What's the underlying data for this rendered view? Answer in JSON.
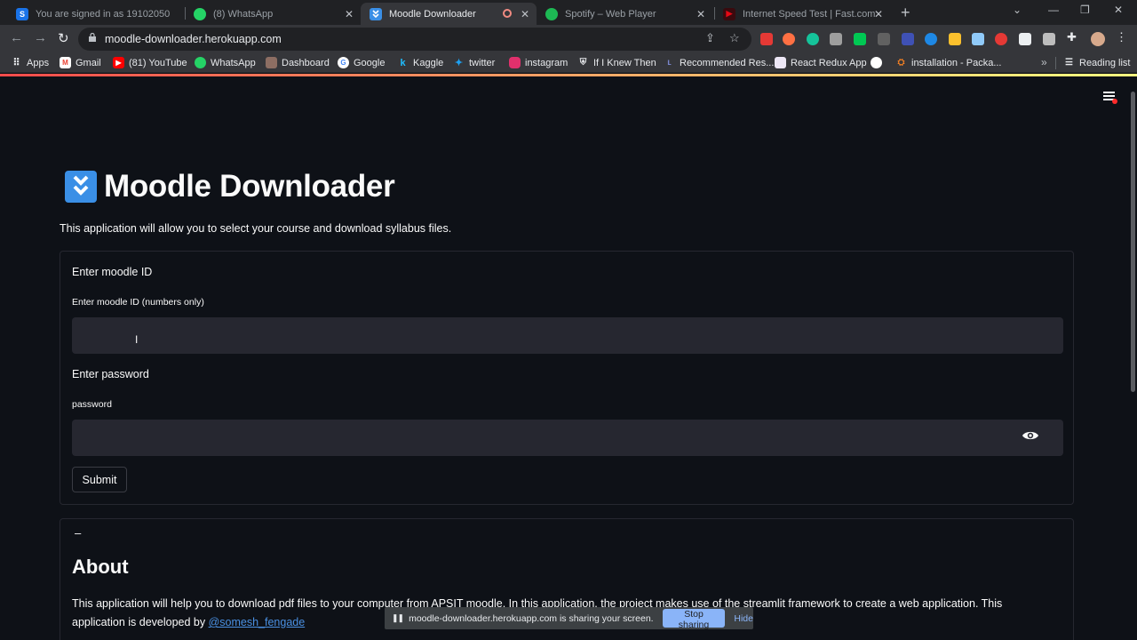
{
  "tabs": [
    {
      "title": "You are signed in as 19102050",
      "favicon_letter": "S",
      "color": "#1a73e8"
    },
    {
      "title": "(8) WhatsApp",
      "favicon_letter": "",
      "color": "#25d366"
    },
    {
      "title": "Moodle Downloader",
      "favicon_letter": "",
      "color": "#3a8fe6",
      "active": true
    },
    {
      "title": "Spotify – Web Player",
      "favicon_letter": "",
      "color": "#1db954"
    },
    {
      "title": "Internet Speed Test | Fast.com",
      "favicon_letter": "",
      "color": "#e50914"
    }
  ],
  "toolbar": {
    "url": "moodle-downloader.herokuapp.com"
  },
  "bookmarks": [
    {
      "label": "Apps",
      "color": "#4285f4"
    },
    {
      "label": "Gmail",
      "color": "#ea4335"
    },
    {
      "label": "(81) YouTube",
      "color": "#ff0000"
    },
    {
      "label": "WhatsApp",
      "color": "#25d366"
    },
    {
      "label": "Dashboard",
      "color": "#8d6e63"
    },
    {
      "label": "Google",
      "color": "#4285f4"
    },
    {
      "label": "Kaggle",
      "color": "#20beff"
    },
    {
      "label": "twitter",
      "color": "#1da1f2"
    },
    {
      "label": "instagram",
      "color": "#e1306c"
    },
    {
      "label": "If I Knew Then",
      "color": "#9e9e9e"
    },
    {
      "label": "Recommended Res...",
      "color": "#3f51b5"
    },
    {
      "label": "React Redux App",
      "color": "#7e57c2"
    },
    {
      "label": "",
      "color": "#ffffff"
    },
    {
      "label": "installation - Packa...",
      "color": "#f48024"
    }
  ],
  "reading_list": "Reading list",
  "page": {
    "title": "Moodle Downloader",
    "intro": "This application will allow you to select your course and download syllabus files.",
    "form": {
      "moodle_heading": "Enter moodle ID",
      "moodle_label": "Enter moodle ID (numbers only)",
      "moodle_value": "",
      "password_heading": "Enter password",
      "password_label": "password",
      "password_value": "",
      "submit_label": "Submit"
    },
    "about": {
      "toggle": "–",
      "title": "About",
      "text": "This application will help you to download pdf files to your computer from APSIT moodle. In this application, the project makes use of the streamlit framework to create a web application. This application is developed by ",
      "author_link": "@somesh_fengade"
    }
  },
  "share_banner": {
    "text": "moodle-downloader.herokuapp.com is sharing your screen.",
    "stop_label": "Stop sharing",
    "hide_label": "Hide"
  }
}
